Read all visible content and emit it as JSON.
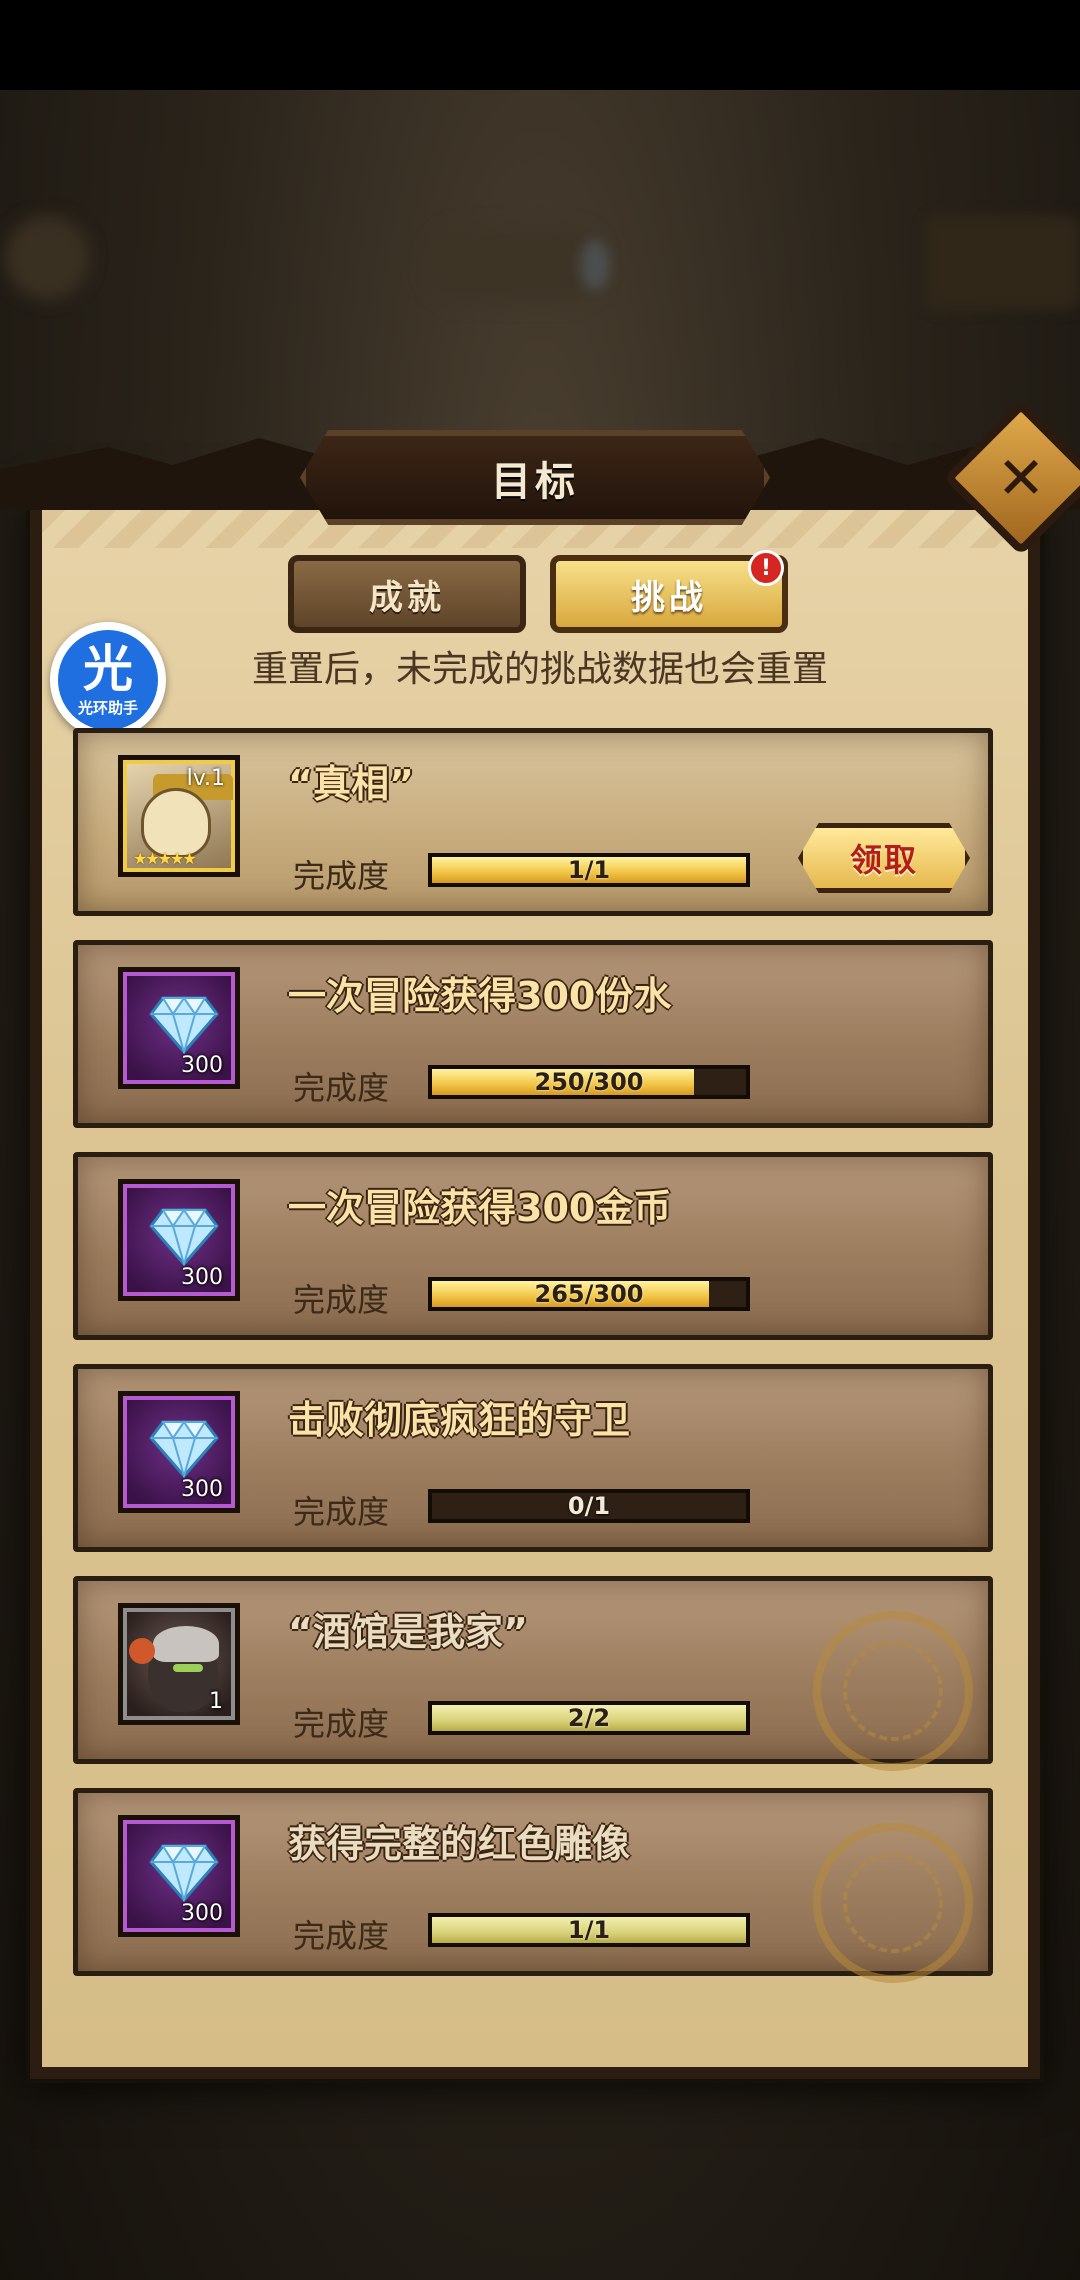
{
  "window": {
    "title": "目标"
  },
  "tabs": [
    {
      "label": "成就",
      "active": false
    },
    {
      "label": "挑战",
      "active": true,
      "badge": "!"
    }
  ],
  "helper_overlay": {
    "char": "光",
    "label": "光环助手"
  },
  "subtitle": "重置后，未完成的挑战数据也会重置",
  "progress_label": "完成度",
  "claim_label": "领取",
  "colors": {
    "accent_gold": "#f2c445",
    "claim_text": "#b31f17",
    "badge_red": "#d52621",
    "panel": "#dcc593"
  },
  "challenges": [
    {
      "title": "“真相”",
      "reward_type": "hero",
      "reward_level": "lv.1",
      "reward_stars": "★★★★★",
      "progress_text": "1/1",
      "progress": 1.0,
      "state": "claimable"
    },
    {
      "title": "一次冒险获得300份水",
      "reward_type": "diamond-icon",
      "reward_qty": "300",
      "progress_text": "250/300",
      "progress": 0.833,
      "state": "in_progress"
    },
    {
      "title": "一次冒险获得300金币",
      "reward_type": "diamond-icon",
      "reward_qty": "300",
      "progress_text": "265/300",
      "progress": 0.883,
      "state": "in_progress"
    },
    {
      "title": "击败彻底疯狂的守卫",
      "reward_type": "diamond-icon",
      "reward_qty": "300",
      "progress_text": "0/1",
      "progress": 0.0,
      "state": "in_progress"
    },
    {
      "title": "“酒馆是我家”",
      "reward_type": "hero",
      "reward_qty": "1",
      "progress_text": "2/2",
      "progress": 1.0,
      "state": "claimed"
    },
    {
      "title": "获得完整的红色雕像",
      "reward_type": "diamond-icon",
      "reward_qty": "300",
      "progress_text": "1/1",
      "progress": 1.0,
      "state": "claimed"
    }
  ]
}
